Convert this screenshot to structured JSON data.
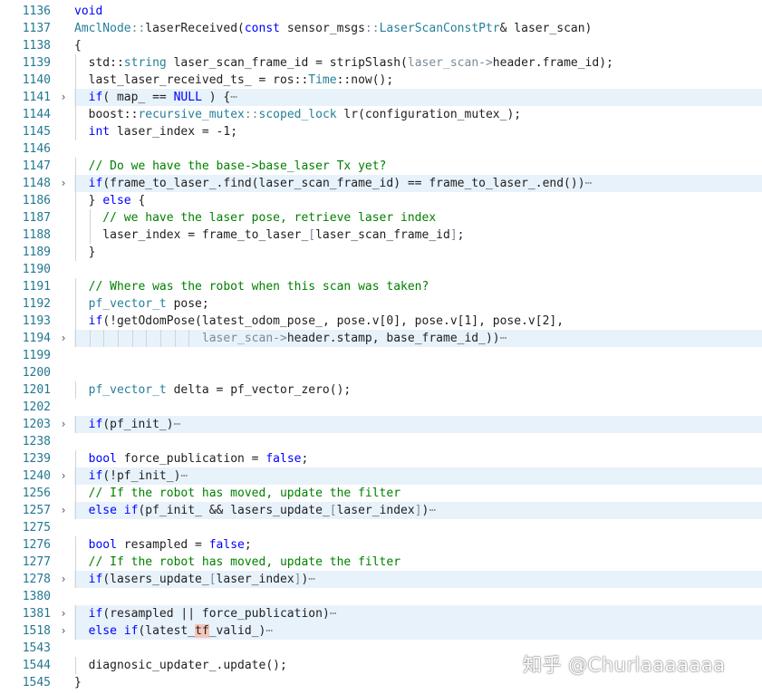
{
  "lines": [
    {
      "n": "1136",
      "fold": false,
      "folded": false,
      "tokens": [
        {
          "t": "void",
          "c": "kw"
        }
      ]
    },
    {
      "n": "1137",
      "fold": false,
      "folded": false,
      "tokens": [
        {
          "t": "AmclNode",
          "c": "ty"
        },
        {
          "t": "::",
          "c": "dim"
        },
        {
          "t": "laserReceived(",
          "c": ""
        },
        {
          "t": "const",
          "c": "kw"
        },
        {
          "t": " sensor_msgs",
          "c": ""
        },
        {
          "t": "::",
          "c": "dim"
        },
        {
          "t": "LaserScanConstPtr",
          "c": "ty"
        },
        {
          "t": "& laser_scan)",
          "c": ""
        }
      ]
    },
    {
      "n": "1138",
      "fold": false,
      "folded": false,
      "tokens": [
        {
          "t": "{",
          "c": ""
        }
      ]
    },
    {
      "n": "1139",
      "fold": false,
      "folded": false,
      "tokens": [
        {
          "t": "  std::",
          "c": ""
        },
        {
          "t": "string",
          "c": "ty"
        },
        {
          "t": " laser_scan_frame_id = stripSlash(",
          "c": ""
        },
        {
          "t": "laser_scan->",
          "c": "dim"
        },
        {
          "t": "header.frame_id);",
          "c": ""
        }
      ]
    },
    {
      "n": "1140",
      "fold": false,
      "folded": false,
      "tokens": [
        {
          "t": "  last_laser_received_ts_ = ros::",
          "c": ""
        },
        {
          "t": "Time",
          "c": "ty"
        },
        {
          "t": "::now();",
          "c": ""
        }
      ]
    },
    {
      "n": "1141",
      "fold": true,
      "folded": true,
      "tokens": [
        {
          "t": "  ",
          "c": ""
        },
        {
          "t": "if",
          "c": "kw"
        },
        {
          "t": "( map_ == ",
          "c": ""
        },
        {
          "t": "NULL",
          "c": "kw"
        },
        {
          "t": " ) {",
          "c": ""
        },
        {
          "t": "⋯",
          "c": "ell"
        }
      ]
    },
    {
      "n": "1144",
      "fold": false,
      "folded": false,
      "tokens": [
        {
          "t": "  boost::",
          "c": ""
        },
        {
          "t": "recursive_mutex",
          "c": "ty"
        },
        {
          "t": "::",
          "c": "dim"
        },
        {
          "t": "scoped_lock",
          "c": "ty"
        },
        {
          "t": " lr(configuration_mutex_);",
          "c": ""
        }
      ]
    },
    {
      "n": "1145",
      "fold": false,
      "folded": false,
      "tokens": [
        {
          "t": "  ",
          "c": ""
        },
        {
          "t": "int",
          "c": "kw"
        },
        {
          "t": " laser_index = -1;",
          "c": ""
        }
      ]
    },
    {
      "n": "1146",
      "fold": false,
      "folded": false,
      "tokens": []
    },
    {
      "n": "1147",
      "fold": false,
      "folded": false,
      "tokens": [
        {
          "t": "  // Do we have the base->base_laser Tx yet?",
          "c": "cm"
        }
      ]
    },
    {
      "n": "1148",
      "fold": true,
      "folded": true,
      "tokens": [
        {
          "t": "  ",
          "c": ""
        },
        {
          "t": "if",
          "c": "kw"
        },
        {
          "t": "(frame_to_laser_.find(laser_scan_frame_id) == frame_to_laser_.end())",
          "c": ""
        },
        {
          "t": "⋯",
          "c": "ell"
        }
      ]
    },
    {
      "n": "1186",
      "fold": false,
      "folded": false,
      "tokens": [
        {
          "t": "  } ",
          "c": ""
        },
        {
          "t": "else",
          "c": "kw"
        },
        {
          "t": " {",
          "c": ""
        }
      ]
    },
    {
      "n": "1187",
      "fold": false,
      "folded": false,
      "tokens": [
        {
          "t": "    // we have the laser pose, retrieve laser index",
          "c": "cm"
        }
      ]
    },
    {
      "n": "1188",
      "fold": false,
      "folded": false,
      "tokens": [
        {
          "t": "    laser_index = frame_to_laser_",
          "c": ""
        },
        {
          "t": "[",
          "c": "dim"
        },
        {
          "t": "laser_scan_frame_id",
          "c": ""
        },
        {
          "t": "]",
          "c": "dim"
        },
        {
          "t": ";",
          "c": ""
        }
      ]
    },
    {
      "n": "1189",
      "fold": false,
      "folded": false,
      "tokens": [
        {
          "t": "  }",
          "c": ""
        }
      ]
    },
    {
      "n": "1190",
      "fold": false,
      "folded": false,
      "tokens": []
    },
    {
      "n": "1191",
      "fold": false,
      "folded": false,
      "tokens": [
        {
          "t": "  // Where was the robot when this scan was taken?",
          "c": "cm"
        }
      ]
    },
    {
      "n": "1192",
      "fold": false,
      "folded": false,
      "tokens": [
        {
          "t": "  ",
          "c": ""
        },
        {
          "t": "pf_vector_t",
          "c": "ty"
        },
        {
          "t": " pose;",
          "c": ""
        }
      ]
    },
    {
      "n": "1193",
      "fold": false,
      "folded": false,
      "tokens": [
        {
          "t": "  ",
          "c": ""
        },
        {
          "t": "if",
          "c": "kw"
        },
        {
          "t": "(!getOdomPose(latest_odom_pose_, pose.v[0], pose.v[1], pose.v[2],",
          "c": ""
        }
      ]
    },
    {
      "n": "1194",
      "fold": true,
      "folded": true,
      "tokens": [
        {
          "t": "                  ",
          "c": ""
        },
        {
          "t": "laser_scan->",
          "c": "dim"
        },
        {
          "t": "header.stamp, base_frame_id_))",
          "c": ""
        },
        {
          "t": "⋯",
          "c": "ell"
        }
      ]
    },
    {
      "n": "1199",
      "fold": false,
      "folded": false,
      "tokens": []
    },
    {
      "n": "1200",
      "fold": false,
      "folded": false,
      "tokens": []
    },
    {
      "n": "1201",
      "fold": false,
      "folded": false,
      "tokens": [
        {
          "t": "  ",
          "c": ""
        },
        {
          "t": "pf_vector_t",
          "c": "ty"
        },
        {
          "t": " delta = pf_vector_zero();",
          "c": ""
        }
      ]
    },
    {
      "n": "1202",
      "fold": false,
      "folded": false,
      "tokens": []
    },
    {
      "n": "1203",
      "fold": true,
      "folded": true,
      "tokens": [
        {
          "t": "  ",
          "c": ""
        },
        {
          "t": "if",
          "c": "kw"
        },
        {
          "t": "(pf_init_)",
          "c": ""
        },
        {
          "t": "⋯",
          "c": "ell"
        }
      ]
    },
    {
      "n": "1238",
      "fold": false,
      "folded": false,
      "tokens": []
    },
    {
      "n": "1239",
      "fold": false,
      "folded": false,
      "tokens": [
        {
          "t": "  ",
          "c": ""
        },
        {
          "t": "bool",
          "c": "kw"
        },
        {
          "t": " force_publication = ",
          "c": ""
        },
        {
          "t": "false",
          "c": "kw"
        },
        {
          "t": ";",
          "c": ""
        }
      ]
    },
    {
      "n": "1240",
      "fold": true,
      "folded": true,
      "tokens": [
        {
          "t": "  ",
          "c": ""
        },
        {
          "t": "if",
          "c": "kw"
        },
        {
          "t": "(!pf_init_)",
          "c": ""
        },
        {
          "t": "⋯",
          "c": "ell"
        }
      ]
    },
    {
      "n": "1256",
      "fold": false,
      "folded": false,
      "tokens": [
        {
          "t": "  // If the robot has moved, update the filter",
          "c": "cm"
        }
      ]
    },
    {
      "n": "1257",
      "fold": true,
      "folded": true,
      "tokens": [
        {
          "t": "  ",
          "c": ""
        },
        {
          "t": "else if",
          "c": "kw"
        },
        {
          "t": "(pf_init_ && lasers_update_",
          "c": ""
        },
        {
          "t": "[",
          "c": "dim"
        },
        {
          "t": "laser_index",
          "c": ""
        },
        {
          "t": "]",
          "c": "dim"
        },
        {
          "t": ")",
          "c": ""
        },
        {
          "t": "⋯",
          "c": "ell"
        }
      ]
    },
    {
      "n": "1275",
      "fold": false,
      "folded": false,
      "tokens": []
    },
    {
      "n": "1276",
      "fold": false,
      "folded": false,
      "tokens": [
        {
          "t": "  ",
          "c": ""
        },
        {
          "t": "bool",
          "c": "kw"
        },
        {
          "t": " resampled = ",
          "c": ""
        },
        {
          "t": "false",
          "c": "kw"
        },
        {
          "t": ";",
          "c": ""
        }
      ]
    },
    {
      "n": "1277",
      "fold": false,
      "folded": false,
      "tokens": [
        {
          "t": "  // If the robot has moved, update the filter",
          "c": "cm"
        }
      ]
    },
    {
      "n": "1278",
      "fold": true,
      "folded": true,
      "tokens": [
        {
          "t": "  ",
          "c": ""
        },
        {
          "t": "if",
          "c": "kw"
        },
        {
          "t": "(lasers_update_",
          "c": ""
        },
        {
          "t": "[",
          "c": "dim"
        },
        {
          "t": "laser_index",
          "c": ""
        },
        {
          "t": "]",
          "c": "dim"
        },
        {
          "t": ")",
          "c": ""
        },
        {
          "t": "⋯",
          "c": "ell"
        }
      ]
    },
    {
      "n": "1380",
      "fold": false,
      "folded": false,
      "tokens": []
    },
    {
      "n": "1381",
      "fold": true,
      "folded": true,
      "tokens": [
        {
          "t": "  ",
          "c": ""
        },
        {
          "t": "if",
          "c": "kw"
        },
        {
          "t": "(resampled || force_publication)",
          "c": ""
        },
        {
          "t": "⋯",
          "c": "ell"
        }
      ]
    },
    {
      "n": "1518",
      "fold": true,
      "folded": true,
      "tokens": [
        {
          "t": "  ",
          "c": ""
        },
        {
          "t": "else if",
          "c": "kw"
        },
        {
          "t": "(latest_",
          "c": ""
        },
        {
          "t": "tf",
          "c": "tfhl"
        },
        {
          "t": "_valid_)",
          "c": ""
        },
        {
          "t": "⋯",
          "c": "ell"
        }
      ]
    },
    {
      "n": "1543",
      "fold": false,
      "folded": false,
      "tokens": []
    },
    {
      "n": "1544",
      "fold": false,
      "folded": false,
      "tokens": [
        {
          "t": "  diagnosic_updater_.update();",
          "c": ""
        }
      ]
    },
    {
      "n": "1545",
      "fold": false,
      "folded": false,
      "tokens": [
        {
          "t": "}",
          "c": ""
        }
      ]
    }
  ],
  "fold_icon": "chevron-right-icon",
  "watermark": "知乎 @Churlaaaaaaa"
}
